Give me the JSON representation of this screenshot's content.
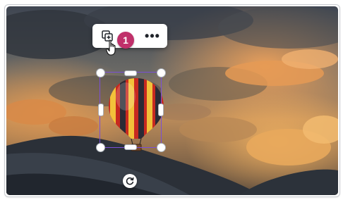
{
  "toolbar": {
    "duplicate_icon": "duplicate-icon",
    "more_label": "•••"
  },
  "step_badge": {
    "label": "1"
  },
  "image": {
    "subject": "hot-air-balloon-icon",
    "background": "sunset-clouds-landscape"
  },
  "rotate_icon": "rotate-icon",
  "colors": {
    "selection": "#7b4fd6",
    "badge": "#c0306a",
    "toolbar_bg": "#ffffff"
  }
}
